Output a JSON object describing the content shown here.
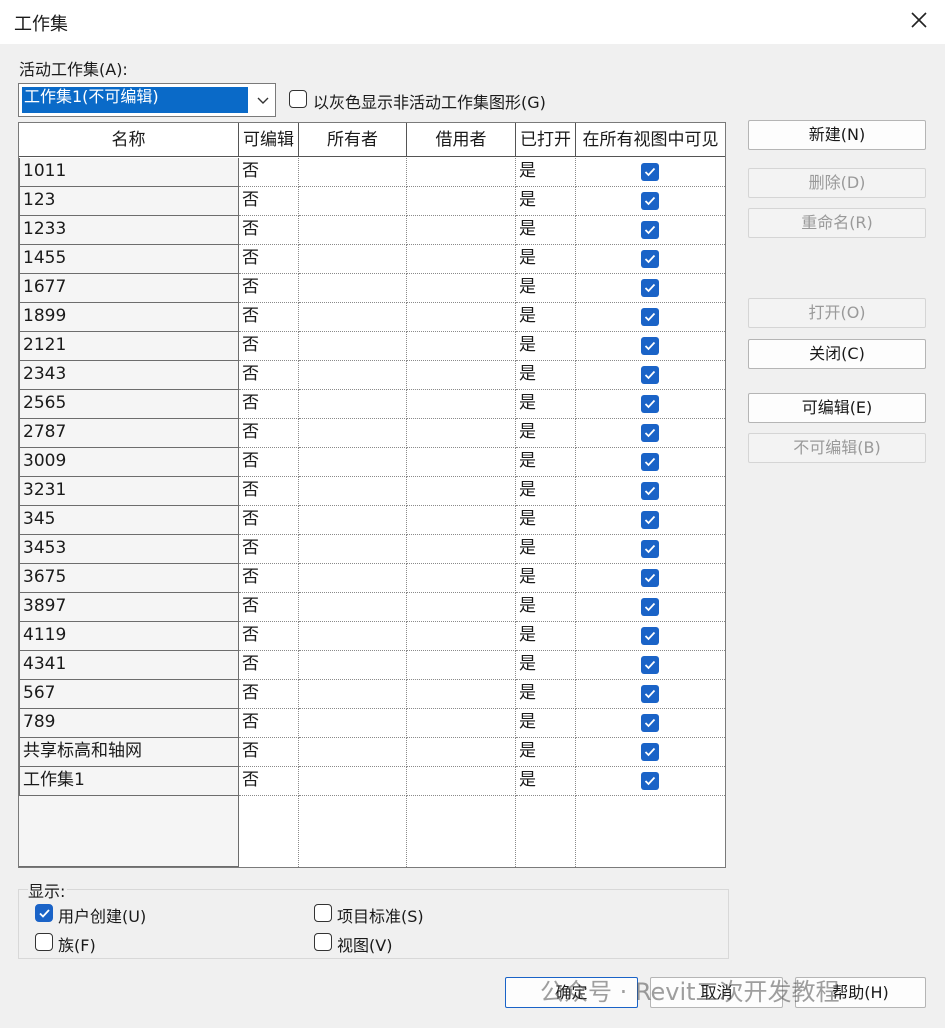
{
  "window": {
    "title": "工作集"
  },
  "active_workset": {
    "label": "活动工作集(A):",
    "selected": "工作集1(不可编辑)"
  },
  "gray_inactive": {
    "label": "以灰色显示非活动工作集图形(G)",
    "checked": false
  },
  "table": {
    "columns": [
      "名称",
      "可编辑",
      "所有者",
      "借用者",
      "已打开",
      "在所有视图中可见"
    ],
    "rows": [
      {
        "name": "1011",
        "editable": "否",
        "owner": "",
        "borrower": "",
        "opened": "是",
        "visible": true
      },
      {
        "name": "123",
        "editable": "否",
        "owner": "",
        "borrower": "",
        "opened": "是",
        "visible": true
      },
      {
        "name": "1233",
        "editable": "否",
        "owner": "",
        "borrower": "",
        "opened": "是",
        "visible": true
      },
      {
        "name": "1455",
        "editable": "否",
        "owner": "",
        "borrower": "",
        "opened": "是",
        "visible": true
      },
      {
        "name": "1677",
        "editable": "否",
        "owner": "",
        "borrower": "",
        "opened": "是",
        "visible": true
      },
      {
        "name": "1899",
        "editable": "否",
        "owner": "",
        "borrower": "",
        "opened": "是",
        "visible": true
      },
      {
        "name": "2121",
        "editable": "否",
        "owner": "",
        "borrower": "",
        "opened": "是",
        "visible": true
      },
      {
        "name": "2343",
        "editable": "否",
        "owner": "",
        "borrower": "",
        "opened": "是",
        "visible": true
      },
      {
        "name": "2565",
        "editable": "否",
        "owner": "",
        "borrower": "",
        "opened": "是",
        "visible": true
      },
      {
        "name": "2787",
        "editable": "否",
        "owner": "",
        "borrower": "",
        "opened": "是",
        "visible": true
      },
      {
        "name": "3009",
        "editable": "否",
        "owner": "",
        "borrower": "",
        "opened": "是",
        "visible": true
      },
      {
        "name": "3231",
        "editable": "否",
        "owner": "",
        "borrower": "",
        "opened": "是",
        "visible": true
      },
      {
        "name": "345",
        "editable": "否",
        "owner": "",
        "borrower": "",
        "opened": "是",
        "visible": true
      },
      {
        "name": "3453",
        "editable": "否",
        "owner": "",
        "borrower": "",
        "opened": "是",
        "visible": true
      },
      {
        "name": "3675",
        "editable": "否",
        "owner": "",
        "borrower": "",
        "opened": "是",
        "visible": true
      },
      {
        "name": "3897",
        "editable": "否",
        "owner": "",
        "borrower": "",
        "opened": "是",
        "visible": true
      },
      {
        "name": "4119",
        "editable": "否",
        "owner": "",
        "borrower": "",
        "opened": "是",
        "visible": true
      },
      {
        "name": "4341",
        "editable": "否",
        "owner": "",
        "borrower": "",
        "opened": "是",
        "visible": true
      },
      {
        "name": "567",
        "editable": "否",
        "owner": "",
        "borrower": "",
        "opened": "是",
        "visible": true
      },
      {
        "name": "789",
        "editable": "否",
        "owner": "",
        "borrower": "",
        "opened": "是",
        "visible": true
      },
      {
        "name": "共享标高和轴网",
        "editable": "否",
        "owner": "",
        "borrower": "",
        "opened": "是",
        "visible": true
      },
      {
        "name": "工作集1",
        "editable": "否",
        "owner": "",
        "borrower": "",
        "opened": "是",
        "visible": true
      }
    ]
  },
  "side_buttons": {
    "new": "新建(N)",
    "delete": "删除(D)",
    "rename": "重命名(R)",
    "open": "打开(O)",
    "close": "关闭(C)",
    "editable": "可编辑(E)",
    "non_editable": "不可编辑(B)"
  },
  "show_group": {
    "title": "显示:",
    "user_created": {
      "label": "用户创建(U)",
      "checked": true
    },
    "families": {
      "label": "族(F)",
      "checked": false
    },
    "project_standards": {
      "label": "项目标准(S)",
      "checked": false
    },
    "views": {
      "label": "视图(V)",
      "checked": false
    }
  },
  "bottom_buttons": {
    "ok": "确定",
    "cancel": "取消",
    "help": "帮助(H)"
  },
  "watermark": "公众号 · Revit二次开发教程",
  "colors": {
    "accent": "#1a63c7",
    "selection": "#0a6ac8",
    "dialog_bg": "#f0f0f0"
  }
}
